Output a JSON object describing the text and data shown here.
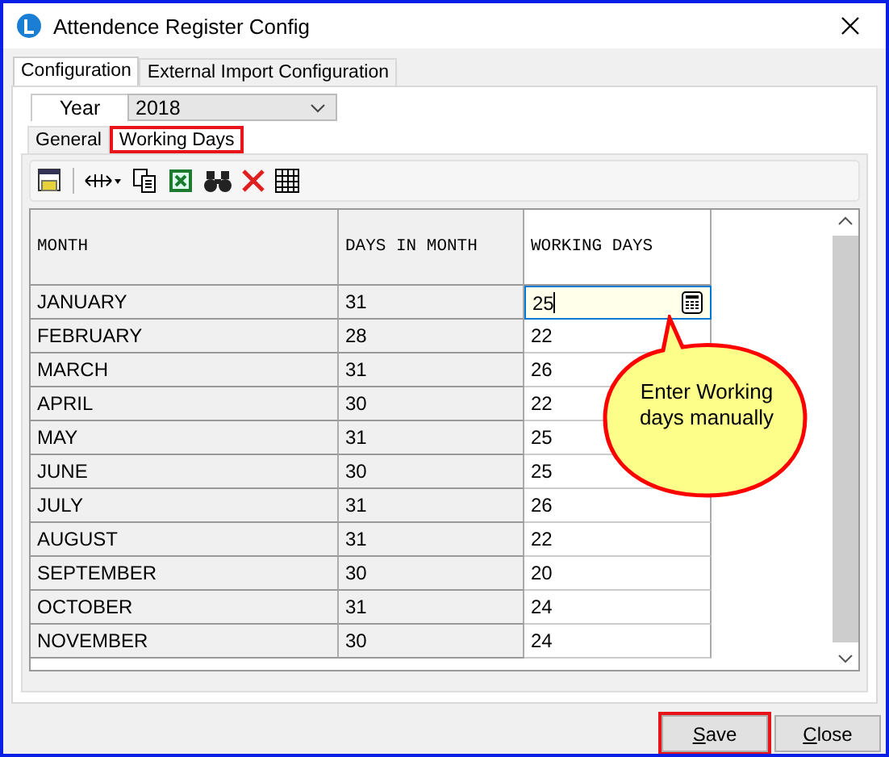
{
  "window": {
    "title": "Attendence Register Config"
  },
  "tabs": [
    {
      "label": "Configuration",
      "selected": true
    },
    {
      "label": "External Import Configuration",
      "selected": false
    }
  ],
  "year": {
    "label": "Year",
    "value": "2018"
  },
  "sub_tabs": [
    {
      "label": "General",
      "selected": false,
      "highlighted": false
    },
    {
      "label": "Working Days",
      "selected": true,
      "highlighted": true
    }
  ],
  "table": {
    "columns": [
      "MONTH",
      "DAYS IN MONTH",
      "WORKING DAYS"
    ],
    "rows": [
      {
        "month": "JANUARY",
        "days": "31",
        "working": "25",
        "editing": true
      },
      {
        "month": "FEBRUARY",
        "days": "28",
        "working": "22",
        "editing": false
      },
      {
        "month": "MARCH",
        "days": "31",
        "working": "26",
        "editing": false
      },
      {
        "month": "APRIL",
        "days": "30",
        "working": "22",
        "editing": false
      },
      {
        "month": "MAY",
        "days": "31",
        "working": "25",
        "editing": false
      },
      {
        "month": "JUNE",
        "days": "30",
        "working": "25",
        "editing": false
      },
      {
        "month": "JULY",
        "days": "31",
        "working": "26",
        "editing": false
      },
      {
        "month": "AUGUST",
        "days": "31",
        "working": "22",
        "editing": false
      },
      {
        "month": "SEPTEMBER",
        "days": "30",
        "working": "20",
        "editing": false
      },
      {
        "month": "OCTOBER",
        "days": "31",
        "working": "24",
        "editing": false
      },
      {
        "month": "NOVEMBER",
        "days": "30",
        "working": "24",
        "editing": false
      }
    ]
  },
  "callout": {
    "text": "Enter Working days manually"
  },
  "buttons": [
    {
      "label": "Save",
      "highlighted": true
    },
    {
      "label": "Close",
      "highlighted": false
    }
  ]
}
